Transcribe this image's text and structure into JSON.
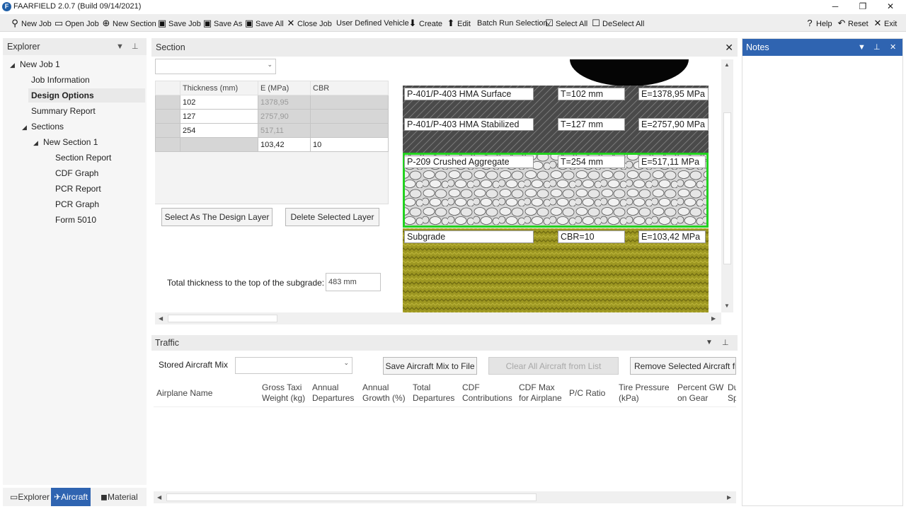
{
  "window": {
    "title": "FAARFIELD 2.0.7 (Build 09/14/2021)",
    "controls": {
      "minimize": "─",
      "restore": "❐",
      "close": "✕"
    }
  },
  "toolbar": {
    "new_job": "New Job",
    "open_job": "Open Job",
    "new_section": "New Section",
    "save_job": "Save Job",
    "save_as": "Save As",
    "save_all": "Save All",
    "close_job": "Close Job",
    "user_defined_vehicle": "User Defined Vehicle",
    "create": "Create",
    "edit": "Edit",
    "batch_run_selection": "Batch Run Selection",
    "select_all": "Select All",
    "deselect_all": "DeSelect All",
    "help": "Help",
    "reset": "Reset",
    "exit": "Exit"
  },
  "explorer": {
    "title": "Explorer",
    "tree": {
      "job": "New Job 1",
      "job_information": "Job Information",
      "design_options": "Design Options",
      "summary_report": "Summary Report",
      "sections": "Sections",
      "section": "New Section 1",
      "section_report": "Section Report",
      "cdf_graph": "CDF Graph",
      "pcr_report": "PCR Report",
      "pcr_graph": "PCR Graph",
      "form_5010": "Form 5010"
    },
    "tabs": {
      "explorer": "Explorer",
      "aircraft": "Aircraft",
      "material": "Material"
    }
  },
  "section": {
    "title": "Section",
    "close": "✕",
    "table": {
      "headers": [
        "Thickness (mm)",
        "E (MPa)",
        "CBR"
      ],
      "rows": [
        [
          "102",
          "1378,95",
          ""
        ],
        [
          "127",
          "2757,90",
          ""
        ],
        [
          "254",
          "517,11",
          ""
        ],
        [
          "",
          "103,42",
          "10"
        ]
      ]
    },
    "buttons": {
      "select_design_layer": "Select As The Design Layer",
      "delete_layer": "Delete Selected Layer"
    },
    "total_thickness_label": "Total thickness to the top of the subgrade:",
    "total_thickness_value": "483 mm",
    "layers": [
      {
        "name": "P-401/P-403 HMA Surface",
        "param": "T=102 mm",
        "modulus": "E=1378,95 MPa"
      },
      {
        "name": "P-401/P-403 HMA Stabilized",
        "param": "T=127 mm",
        "modulus": "E=2757,90 MPa"
      },
      {
        "name": "P-209 Crushed Aggregate",
        "param": "T=254 mm",
        "modulus": "E=517,11 MPa"
      },
      {
        "name": "Subgrade",
        "param": "CBR=10",
        "modulus": "E=103,42 MPa"
      }
    ],
    "colors": {
      "hma": "#4a4a4a",
      "aggregate": "#d8d8d8",
      "subgrade": "#9d9722",
      "selected_border": "#22d11f"
    }
  },
  "traffic": {
    "title": "Traffic",
    "stored_mix_label": "Stored Aircraft Mix",
    "buttons": {
      "save_mix": "Save Aircraft Mix to File",
      "clear_all": "Clear All Aircraft from List",
      "remove_selected": "Remove Selected Aircraft fro"
    },
    "columns": [
      [
        "Airplane Name",
        ""
      ],
      [
        "Gross Taxi",
        "Weight (kg)"
      ],
      [
        "Annual",
        "Departures"
      ],
      [
        "Annual",
        "Growth (%)"
      ],
      [
        "Total",
        "Departures"
      ],
      [
        "CDF",
        "Contributions"
      ],
      [
        "CDF Max",
        "for Airplane"
      ],
      [
        "P/C Ratio",
        ""
      ],
      [
        "Tire Pressure",
        "(kPa)"
      ],
      [
        "Percent GW",
        "on Gear"
      ],
      [
        "Du",
        "Sp"
      ]
    ]
  },
  "notes": {
    "title": "Notes"
  }
}
